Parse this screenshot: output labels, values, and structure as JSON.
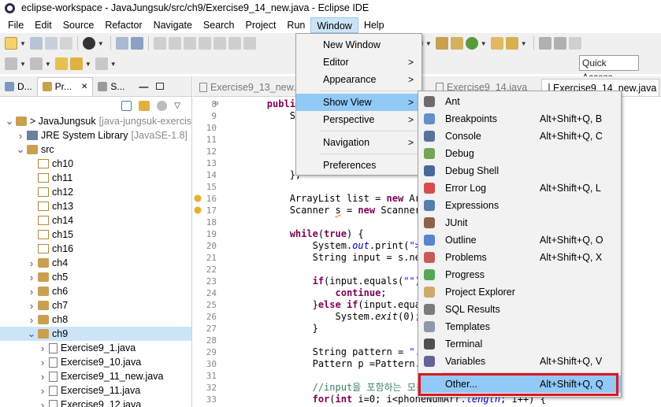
{
  "window": {
    "title": "eclipse-workspace - JavaJungsuk/src/ch9/Exercise9_14_new.java - Eclipse IDE"
  },
  "menubar": [
    "File",
    "Edit",
    "Source",
    "Refactor",
    "Navigate",
    "Search",
    "Project",
    "Run",
    "Window",
    "Help"
  ],
  "toolbar": {
    "quick_access": "Quick Access"
  },
  "left_panel": {
    "tabs": [
      "D...",
      "Pr...",
      "S..."
    ],
    "close_glyph": "✕",
    "tree": [
      {
        "label": "> JavaJungsuk",
        "suffix": "[java-jungsuk-exercis",
        "indent": 0,
        "arrow": "v",
        "icon": "project"
      },
      {
        "label": "JRE System Library",
        "suffix": "[JavaSE-1.8]",
        "indent": 1,
        "arrow": ">",
        "icon": "library"
      },
      {
        "label": "src",
        "suffix": "",
        "indent": 1,
        "arrow": "v",
        "icon": "src"
      },
      {
        "label": "ch10",
        "suffix": "",
        "indent": 2,
        "arrow": "",
        "icon": "pkg-empty"
      },
      {
        "label": "ch11",
        "suffix": "",
        "indent": 2,
        "arrow": "",
        "icon": "pkg-empty"
      },
      {
        "label": "ch12",
        "suffix": "",
        "indent": 2,
        "arrow": "",
        "icon": "pkg-empty"
      },
      {
        "label": "ch13",
        "suffix": "",
        "indent": 2,
        "arrow": "",
        "icon": "pkg-empty"
      },
      {
        "label": "ch14",
        "suffix": "",
        "indent": 2,
        "arrow": "",
        "icon": "pkg-empty"
      },
      {
        "label": "ch15",
        "suffix": "",
        "indent": 2,
        "arrow": "",
        "icon": "pkg-empty"
      },
      {
        "label": "ch16",
        "suffix": "",
        "indent": 2,
        "arrow": "",
        "icon": "pkg-empty"
      },
      {
        "label": "ch4",
        "suffix": "",
        "indent": 2,
        "arrow": ">",
        "icon": "pkg"
      },
      {
        "label": "ch5",
        "suffix": "",
        "indent": 2,
        "arrow": ">",
        "icon": "pkg"
      },
      {
        "label": "ch6",
        "suffix": "",
        "indent": 2,
        "arrow": ">",
        "icon": "pkg"
      },
      {
        "label": "ch7",
        "suffix": "",
        "indent": 2,
        "arrow": ">",
        "icon": "pkg"
      },
      {
        "label": "ch8",
        "suffix": "",
        "indent": 2,
        "arrow": ">",
        "icon": "pkg"
      },
      {
        "label": "ch9",
        "suffix": "",
        "indent": 2,
        "arrow": "v",
        "icon": "pkg",
        "selected": true
      },
      {
        "label": "Exercise9_1.java",
        "suffix": "",
        "indent": 3,
        "arrow": ">",
        "icon": "java"
      },
      {
        "label": "Exercise9_10.java",
        "suffix": "",
        "indent": 3,
        "arrow": ">",
        "icon": "java"
      },
      {
        "label": "Exercise9_11_new.java",
        "suffix": "",
        "indent": 3,
        "arrow": ">",
        "icon": "java"
      },
      {
        "label": "Exercise9_11.java",
        "suffix": "",
        "indent": 3,
        "arrow": ">",
        "icon": "java"
      },
      {
        "label": "Exercise9_12.java",
        "suffix": "",
        "indent": 3,
        "arrow": ">",
        "icon": "java"
      }
    ]
  },
  "editor": {
    "tabs": [
      {
        "label": "Exercise9_13_new.java",
        "selected": false
      },
      {
        "label": "Exercise9_14.java",
        "selected": false
      },
      {
        "label": "Exercise9_14_new.java",
        "selected": true
      }
    ],
    "lines": [
      {
        "n": "8",
        "mark": "fold",
        "parts": [
          [
            "",
            "        "
          ],
          [
            "kw",
            "public st"
          ]
        ]
      },
      {
        "n": "9",
        "mark": "",
        "parts": [
          [
            "",
            "            Strin"
          ]
        ]
      },
      {
        "n": "10",
        "mark": "",
        "parts": [
          [
            "",
            ""
          ]
        ]
      },
      {
        "n": "11",
        "mark": "",
        "parts": [
          [
            "",
            ""
          ]
        ]
      },
      {
        "n": "12",
        "mark": "",
        "parts": [
          [
            "",
            ""
          ]
        ]
      },
      {
        "n": "13",
        "mark": "",
        "parts": [
          [
            "",
            ""
          ]
        ]
      },
      {
        "n": "14",
        "mark": "",
        "parts": [
          [
            "",
            "            };"
          ]
        ]
      },
      {
        "n": "15",
        "mark": "",
        "parts": [
          [
            "",
            ""
          ]
        ]
      },
      {
        "n": "16",
        "mark": "warn",
        "parts": [
          [
            "",
            "            ArrayList list = "
          ],
          [
            "kw",
            "new"
          ],
          [
            "",
            " ArrayL"
          ]
        ]
      },
      {
        "n": "17",
        "mark": "warn",
        "parts": [
          [
            "",
            "            Scanner "
          ],
          [
            "ul",
            "s"
          ],
          [
            "",
            " = "
          ],
          [
            "kw",
            "new"
          ],
          [
            "",
            " Scanner(Sys"
          ]
        ]
      },
      {
        "n": "18",
        "mark": "",
        "parts": [
          [
            "",
            ""
          ]
        ]
      },
      {
        "n": "19",
        "mark": "",
        "parts": [
          [
            "",
            "            "
          ],
          [
            "kw",
            "while"
          ],
          [
            "",
            "("
          ],
          [
            "kw",
            "true"
          ],
          [
            "",
            ") {"
          ]
        ]
      },
      {
        "n": "20",
        "mark": "",
        "parts": [
          [
            "",
            "                System."
          ],
          [
            "it",
            "out"
          ],
          [
            "",
            ".print("
          ],
          [
            "str",
            "\">>\""
          ],
          [
            "",
            ");"
          ]
        ]
      },
      {
        "n": "21",
        "mark": "",
        "parts": [
          [
            "",
            "                String input = s.nextLi"
          ]
        ]
      },
      {
        "n": "22",
        "mark": "",
        "parts": [
          [
            "",
            ""
          ]
        ]
      },
      {
        "n": "23",
        "mark": "",
        "parts": [
          [
            "",
            "                "
          ],
          [
            "kw",
            "if"
          ],
          [
            "",
            "(input.equals("
          ],
          [
            "str",
            "\"\""
          ],
          [
            "",
            ")) {"
          ]
        ]
      },
      {
        "n": "24",
        "mark": "",
        "parts": [
          [
            "",
            "                    "
          ],
          [
            "kw",
            "continue"
          ],
          [
            "",
            ";"
          ]
        ]
      },
      {
        "n": "25",
        "mark": "",
        "parts": [
          [
            "",
            "                }"
          ],
          [
            "kw",
            "else if"
          ],
          [
            "",
            "(input.equalsIg"
          ]
        ]
      },
      {
        "n": "26",
        "mark": "",
        "parts": [
          [
            "",
            "                    System."
          ],
          [
            "itb",
            "exit"
          ],
          [
            "",
            "(0);"
          ]
        ]
      },
      {
        "n": "27",
        "mark": "",
        "parts": [
          [
            "",
            "                }"
          ]
        ]
      },
      {
        "n": "28",
        "mark": "",
        "parts": [
          [
            "",
            ""
          ]
        ]
      },
      {
        "n": "29",
        "mark": "",
        "parts": [
          [
            "",
            "                String pattern = "
          ],
          [
            "str",
            "\".*\""
          ],
          [
            "",
            "+i"
          ]
        ]
      },
      {
        "n": "30",
        "mark": "",
        "parts": [
          [
            "",
            "                Pattern p =Pattern."
          ],
          [
            "itb",
            "comp"
          ]
        ]
      },
      {
        "n": "31",
        "mark": "",
        "parts": [
          [
            "",
            ""
          ]
        ]
      },
      {
        "n": "32",
        "mark": "",
        "parts": [
          [
            "",
            "                "
          ],
          [
            "cm",
            "//input을 포함하는 모든 문자열"
          ]
        ]
      },
      {
        "n": "33",
        "mark": "",
        "parts": [
          [
            "",
            "                "
          ],
          [
            "kw",
            "for"
          ],
          [
            "",
            "("
          ],
          [
            "kw",
            "int"
          ],
          [
            "",
            " i=0; i<phoneNumArr."
          ],
          [
            "it",
            "length"
          ],
          [
            "",
            "; i++) {"
          ]
        ]
      }
    ]
  },
  "window_menu": {
    "items": [
      {
        "label": "New Window",
        "submenu": false,
        "sep_after": false
      },
      {
        "label": "Editor",
        "submenu": true,
        "sep_after": false
      },
      {
        "label": "Appearance",
        "submenu": true,
        "sep_after": true
      },
      {
        "label": "Show View",
        "submenu": true,
        "sep_after": false,
        "highlight": true
      },
      {
        "label": "Perspective",
        "submenu": true,
        "sep_after": true
      },
      {
        "label": "Navigation",
        "submenu": true,
        "sep_after": true
      },
      {
        "label": "Preferences",
        "submenu": false,
        "sep_after": false
      }
    ],
    "submenu_glyph": ">"
  },
  "show_view_menu": {
    "items": [
      {
        "label": "Ant",
        "shortcut": "",
        "icon": "ant-icon",
        "color": "#555555"
      },
      {
        "label": "Breakpoints",
        "shortcut": "Alt+Shift+Q, B",
        "icon": "breakpoints-icon",
        "color": "#4a7fc1"
      },
      {
        "label": "Console",
        "shortcut": "Alt+Shift+Q, C",
        "icon": "console-icon",
        "color": "#3c5d8a"
      },
      {
        "label": "Debug",
        "shortcut": "",
        "icon": "debug-icon",
        "color": "#5a9a3a"
      },
      {
        "label": "Debug Shell",
        "shortcut": "",
        "icon": "debug-shell-icon",
        "color": "#2c4f8a"
      },
      {
        "label": "Error Log",
        "shortcut": "Alt+Shift+Q, L",
        "icon": "error-log-icon",
        "color": "#d03030"
      },
      {
        "label": "Expressions",
        "shortcut": "",
        "icon": "expressions-icon",
        "color": "#3a6aa0"
      },
      {
        "label": "JUnit",
        "shortcut": "",
        "icon": "junit-icon",
        "color": "#7a4a2a"
      },
      {
        "label": "Outline",
        "shortcut": "Alt+Shift+Q, O",
        "icon": "outline-icon",
        "color": "#3b73c4"
      },
      {
        "label": "Problems",
        "shortcut": "Alt+Shift+Q, X",
        "icon": "problems-icon",
        "color": "#c04040"
      },
      {
        "label": "Progress",
        "shortcut": "",
        "icon": "progress-icon",
        "color": "#3a9a3a"
      },
      {
        "label": "Project Explorer",
        "shortcut": "",
        "icon": "project-explorer-icon",
        "color": "#c8a050"
      },
      {
        "label": "SQL Results",
        "shortcut": "",
        "icon": "sql-results-icon",
        "color": "#666666"
      },
      {
        "label": "Templates",
        "shortcut": "",
        "icon": "templates-icon",
        "color": "#7a8aa0"
      },
      {
        "label": "Terminal",
        "shortcut": "",
        "icon": "terminal-icon",
        "color": "#333333"
      },
      {
        "label": "Variables",
        "shortcut": "Alt+Shift+Q, V",
        "icon": "variables-icon",
        "color": "#4a4a8a"
      },
      {
        "label": "Other...",
        "shortcut": "Alt+Shift+Q, Q",
        "icon": "",
        "color": "",
        "highlight": true,
        "sep_before": true
      }
    ]
  },
  "colors": {
    "highlight": "#91c9f7",
    "annotation_box": "#e0141e",
    "selection": "#cce4f7"
  }
}
